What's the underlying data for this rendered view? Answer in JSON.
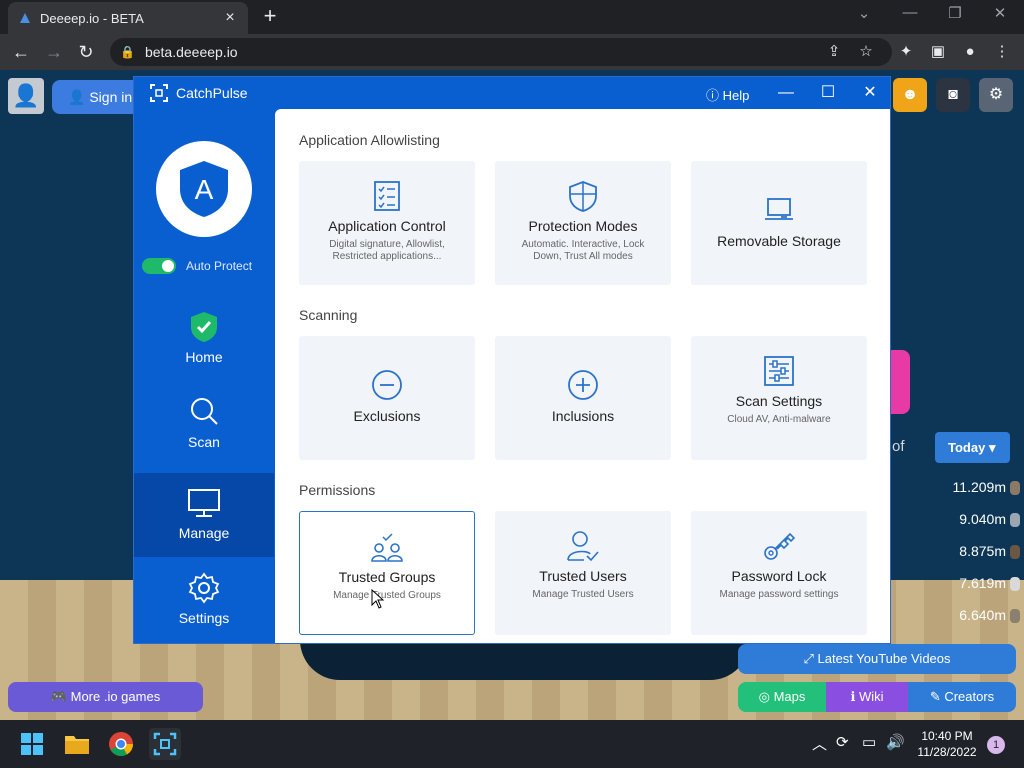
{
  "browser": {
    "tab_title": "Deeeep.io - BETA",
    "url": "beta.deeeep.io"
  },
  "page": {
    "sign_in": "Sign in",
    "of_text": "of",
    "today_button": "Today",
    "leaderboard": [
      {
        "score": "11.209m",
        "color": "#8d7a66"
      },
      {
        "score": "9.040m",
        "color": "#9aa6b2"
      },
      {
        "score": "8.875m",
        "color": "#6b5744"
      },
      {
        "score": "7.619m",
        "color": "#d9d9d9"
      },
      {
        "score": "6.640m",
        "color": "#8a8070"
      }
    ],
    "youtube_button": "Latest YouTube Videos",
    "more_games_button": "More .io games",
    "maps_button": "Maps",
    "wiki_button": "Wiki",
    "creators_button": "Creators"
  },
  "app": {
    "name": "CatchPulse",
    "help": "Help",
    "shield_letter": "A",
    "auto_protect": "Auto Protect",
    "nav": [
      {
        "label": "Home",
        "icon": "shield-check-icon"
      },
      {
        "label": "Scan",
        "icon": "magnifier-icon"
      },
      {
        "label": "Manage",
        "icon": "monitor-icon"
      },
      {
        "label": "Settings",
        "icon": "gear-icon"
      }
    ],
    "sections": {
      "allowlisting": "Application Allowlisting",
      "scanning": "Scanning",
      "permissions": "Permissions"
    },
    "cards": {
      "app_control": {
        "title": "Application Control",
        "desc": "Digital signature, Allowlist, Restricted applications..."
      },
      "protection_modes": {
        "title": "Protection Modes",
        "desc": "Automatic. Interactive, Lock Down, Trust All modes"
      },
      "removable_storage": {
        "title": "Removable Storage",
        "desc": ""
      },
      "exclusions": {
        "title": "Exclusions",
        "desc": ""
      },
      "inclusions": {
        "title": "Inclusions",
        "desc": ""
      },
      "scan_settings": {
        "title": "Scan Settings",
        "desc": "Cloud AV, Anti-malware"
      },
      "trusted_groups": {
        "title": "Trusted Groups",
        "desc": "Manage Trusted Groups"
      },
      "trusted_users": {
        "title": "Trusted Users",
        "desc": "Manage Trusted Users"
      },
      "password_lock": {
        "title": "Password Lock",
        "desc": "Manage password settings"
      }
    }
  },
  "taskbar": {
    "time": "10:40 PM",
    "date": "11/28/2022",
    "notifications": "1"
  },
  "colors": {
    "accent": "#0a5fd0",
    "nav_active": "#0548a8",
    "toggle_on": "#1fb96a"
  }
}
